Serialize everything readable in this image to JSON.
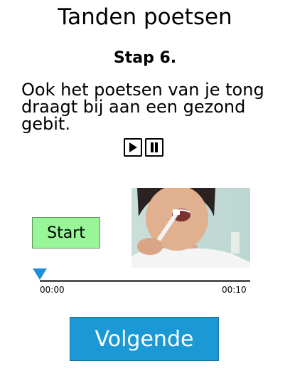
{
  "header": {
    "title": "Tanden poetsen"
  },
  "step": {
    "label": "Stap 6.",
    "instruction": "Ook het poetsen van je tong draagt bij aan een gezond gebit."
  },
  "audio": {
    "play_icon": "play-icon",
    "pause_icon": "pause-icon"
  },
  "video": {
    "start_label": "Start",
    "current_time": "00:00",
    "total_time": "00:10",
    "progress": 0
  },
  "footer": {
    "next_label": "Volgende"
  },
  "colors": {
    "start_button": "#98f598",
    "next_button": "#1a99d5",
    "timeline_knob": "#1e90d8"
  }
}
